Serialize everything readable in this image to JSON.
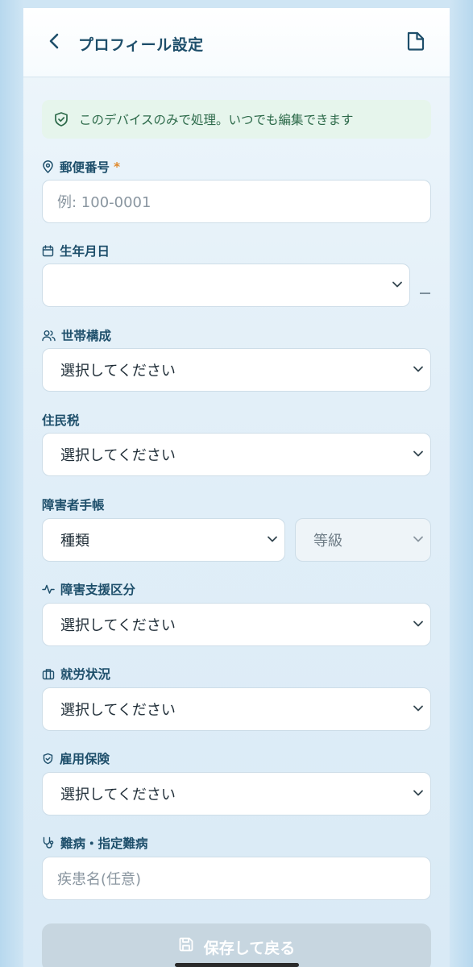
{
  "header": {
    "title": "プロフィール設定",
    "back_icon": "chevron-left-icon",
    "doc_icon": "document-icon"
  },
  "notice": {
    "text": "このデバイスのみで処理。いつでも編集できます",
    "icon": "shield-check-icon"
  },
  "fields": {
    "postal": {
      "label": "郵便番号",
      "required_mark": "*",
      "placeholder": "例: 100-0001"
    },
    "birth": {
      "label": "生年月日",
      "value": "",
      "separator": "–"
    },
    "household": {
      "label": "世帯構成",
      "value": "選択してください"
    },
    "resident_tax": {
      "label": "住民税",
      "value": "選択してください"
    },
    "disability_book": {
      "label": "障害者手帳",
      "type_value": "種類",
      "grade_value": "等級"
    },
    "support_category": {
      "label": "障害支援区分",
      "value": "選択してください"
    },
    "employment": {
      "label": "就労状況",
      "value": "選択してください"
    },
    "insurance": {
      "label": "雇用保険",
      "value": "選択してください"
    },
    "disease": {
      "label": "難病・指定難病",
      "placeholder": "疾患名(任意)"
    }
  },
  "save_button": {
    "label": "保存して戻る",
    "icon": "save-icon"
  },
  "colors": {
    "title": "#1d4e6a",
    "accent_required": "#e08a2c",
    "notice_bg": "#e6f5ec",
    "notice_text": "#2d6a4a",
    "save_bg": "#c7d6e0"
  }
}
